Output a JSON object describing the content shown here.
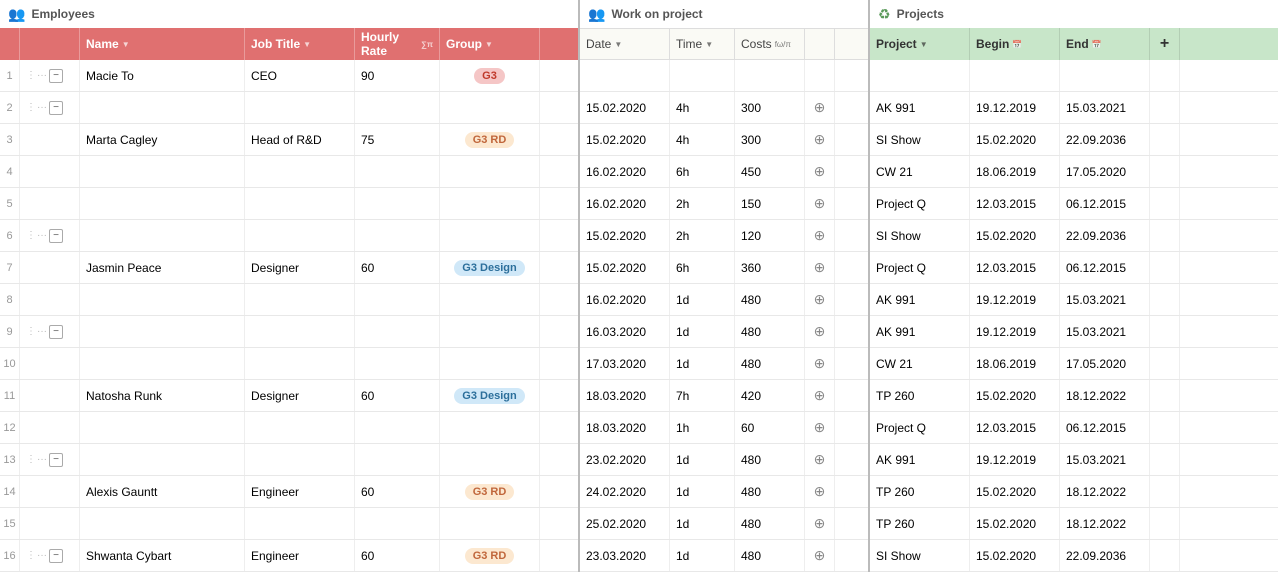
{
  "sections": {
    "employees": {
      "label": "Employees",
      "icon": "employees-icon"
    },
    "work": {
      "label": "Work on project",
      "icon": "work-icon"
    },
    "projects": {
      "label": "Projects",
      "icon": "projects-icon"
    }
  },
  "employees_headers": {
    "name": "Name",
    "job_title": "Job Title",
    "hourly_rate": "Hourly Rate",
    "group": "Group"
  },
  "work_headers": {
    "date": "Date",
    "time": "Time",
    "costs": "Costs"
  },
  "project_headers": {
    "project": "Project",
    "begin": "Begin",
    "end": "End"
  },
  "rows": [
    {
      "row_num": "1",
      "has_expand": true,
      "expand_state": "minus",
      "show_dots": true,
      "name": "Macie To",
      "job": "CEO",
      "hourly": "90",
      "group_tag": "G3",
      "group_class": "tag-g3",
      "work_rows": []
    },
    {
      "row_num": "2",
      "has_expand": true,
      "expand_state": "minus",
      "show_dots": true,
      "name": "",
      "job": "",
      "hourly": "",
      "group_tag": "",
      "group_class": "",
      "work_rows": [
        {
          "date": "15.02.2020",
          "time": "4h",
          "costs": "300",
          "project": "AK 991",
          "begin": "19.12.2019",
          "end": "15.03.2021"
        }
      ]
    },
    {
      "row_num": "3",
      "has_expand": false,
      "expand_state": "",
      "show_dots": false,
      "name": "Marta Cagley",
      "job": "Head of R&D",
      "hourly": "75",
      "group_tag": "G3 RD",
      "group_class": "tag-g3rd",
      "work_rows": [
        {
          "date": "15.02.2020",
          "time": "4h",
          "costs": "300",
          "project": "SI Show",
          "begin": "15.02.2020",
          "end": "22.09.2036"
        }
      ]
    },
    {
      "row_num": "4",
      "has_expand": false,
      "expand_state": "",
      "show_dots": false,
      "name": "",
      "job": "",
      "hourly": "",
      "group_tag": "",
      "group_class": "",
      "work_rows": [
        {
          "date": "16.02.2020",
          "time": "6h",
          "costs": "450",
          "project": "CW 21",
          "begin": "18.06.2019",
          "end": "17.05.2020"
        }
      ]
    },
    {
      "row_num": "5",
      "has_expand": false,
      "expand_state": "",
      "show_dots": false,
      "name": "",
      "job": "",
      "hourly": "",
      "group_tag": "",
      "group_class": "",
      "work_rows": [
        {
          "date": "16.02.2020",
          "time": "2h",
          "costs": "150",
          "project": "Project Q",
          "begin": "12.03.2015",
          "end": "06.12.2015"
        }
      ]
    },
    {
      "row_num": "6",
      "has_expand": true,
      "expand_state": "minus",
      "show_dots": true,
      "name": "",
      "job": "",
      "hourly": "",
      "group_tag": "",
      "group_class": "",
      "work_rows": [
        {
          "date": "15.02.2020",
          "time": "2h",
          "costs": "120",
          "project": "SI Show",
          "begin": "15.02.2020",
          "end": "22.09.2036"
        }
      ]
    },
    {
      "row_num": "7",
      "has_expand": false,
      "expand_state": "",
      "show_dots": false,
      "name": "Jasmin Peace",
      "job": "Designer",
      "hourly": "60",
      "group_tag": "G3 Design",
      "group_class": "tag-g3design",
      "work_rows": [
        {
          "date": "15.02.2020",
          "time": "6h",
          "costs": "360",
          "project": "Project Q",
          "begin": "12.03.2015",
          "end": "06.12.2015"
        }
      ]
    },
    {
      "row_num": "8",
      "has_expand": false,
      "expand_state": "",
      "show_dots": false,
      "name": "",
      "job": "",
      "hourly": "",
      "group_tag": "",
      "group_class": "",
      "work_rows": [
        {
          "date": "16.02.2020",
          "time": "1d",
          "costs": "480",
          "project": "AK 991",
          "begin": "19.12.2019",
          "end": "15.03.2021"
        }
      ]
    },
    {
      "row_num": "9",
      "has_expand": true,
      "expand_state": "minus",
      "show_dots": true,
      "name": "",
      "job": "",
      "hourly": "",
      "group_tag": "",
      "group_class": "",
      "work_rows": [
        {
          "date": "16.03.2020",
          "time": "1d",
          "costs": "480",
          "project": "AK 991",
          "begin": "19.12.2019",
          "end": "15.03.2021"
        }
      ]
    },
    {
      "row_num": "10",
      "has_expand": false,
      "expand_state": "",
      "show_dots": false,
      "name": "",
      "job": "",
      "hourly": "",
      "group_tag": "",
      "group_class": "",
      "work_rows": [
        {
          "date": "17.03.2020",
          "time": "1d",
          "costs": "480",
          "project": "CW 21",
          "begin": "18.06.2019",
          "end": "17.05.2020"
        }
      ]
    },
    {
      "row_num": "11",
      "has_expand": false,
      "expand_state": "",
      "show_dots": false,
      "name": "Natosha Runk",
      "job": "Designer",
      "hourly": "60",
      "group_tag": "G3 Design",
      "group_class": "tag-g3design",
      "work_rows": [
        {
          "date": "18.03.2020",
          "time": "7h",
          "costs": "420",
          "project": "TP 260",
          "begin": "15.02.2020",
          "end": "18.12.2022"
        }
      ]
    },
    {
      "row_num": "12",
      "has_expand": false,
      "expand_state": "",
      "show_dots": false,
      "name": "",
      "job": "",
      "hourly": "",
      "group_tag": "",
      "group_class": "",
      "work_rows": [
        {
          "date": "18.03.2020",
          "time": "1h",
          "costs": "60",
          "project": "Project Q",
          "begin": "12.03.2015",
          "end": "06.12.2015"
        }
      ]
    },
    {
      "row_num": "13",
      "has_expand": true,
      "expand_state": "minus",
      "show_dots": true,
      "name": "",
      "job": "",
      "hourly": "",
      "group_tag": "",
      "group_class": "",
      "work_rows": [
        {
          "date": "23.02.2020",
          "time": "1d",
          "costs": "480",
          "project": "AK 991",
          "begin": "19.12.2019",
          "end": "15.03.2021"
        }
      ]
    },
    {
      "row_num": "14",
      "has_expand": false,
      "expand_state": "",
      "show_dots": false,
      "name": "Alexis Gauntt",
      "job": "Engineer",
      "hourly": "60",
      "group_tag": "G3 RD",
      "group_class": "tag-g3rd",
      "work_rows": [
        {
          "date": "24.02.2020",
          "time": "1d",
          "costs": "480",
          "project": "TP 260",
          "begin": "15.02.2020",
          "end": "18.12.2022"
        }
      ]
    },
    {
      "row_num": "15",
      "has_expand": false,
      "expand_state": "",
      "show_dots": false,
      "name": "",
      "job": "",
      "hourly": "",
      "group_tag": "",
      "group_class": "",
      "work_rows": [
        {
          "date": "25.02.2020",
          "time": "1d",
          "costs": "480",
          "project": "TP 260",
          "begin": "15.02.2020",
          "end": "18.12.2022"
        }
      ]
    },
    {
      "row_num": "16",
      "has_expand": true,
      "expand_state": "minus",
      "show_dots": true,
      "name": "Shwanta Cybart",
      "job": "Engineer",
      "hourly": "60",
      "group_tag": "G3 RD",
      "group_class": "tag-g3rd",
      "work_rows": [
        {
          "date": "23.03.2020",
          "time": "1d",
          "costs": "480",
          "project": "SI Show",
          "begin": "15.02.2020",
          "end": "22.09.2036"
        }
      ]
    }
  ],
  "add_col_label": "+",
  "colors": {
    "emp_header_bg": "#e07070",
    "work_header_bg": "#fafaf5",
    "proj_header_bg": "#c8e6c9"
  }
}
